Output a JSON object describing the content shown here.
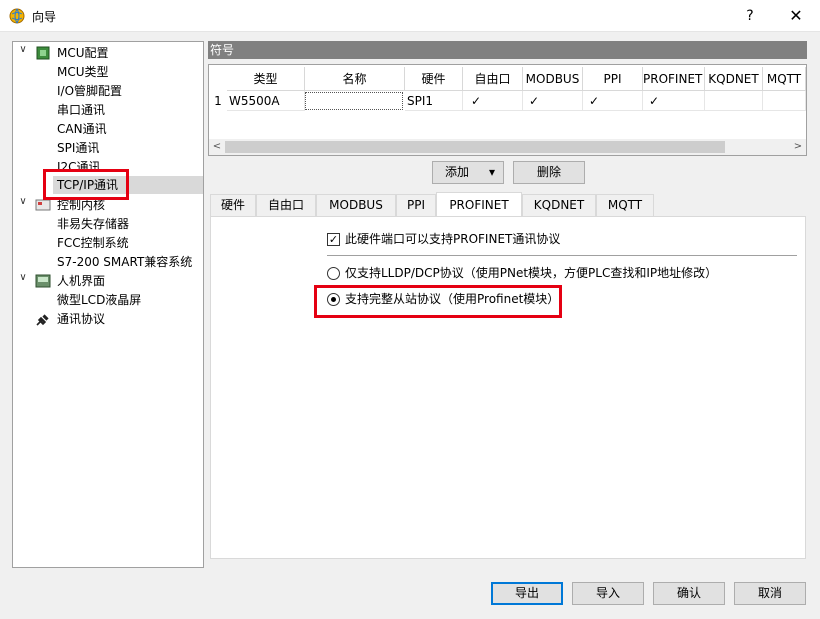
{
  "window": {
    "title": "向导",
    "help": "?",
    "close": "✕"
  },
  "tree": {
    "nodes": [
      {
        "label": "MCU配置",
        "toggle": "∨",
        "icon": "chip-icon"
      },
      {
        "label": "MCU类型"
      },
      {
        "label": "I/O管脚配置"
      },
      {
        "label": "串口通讯"
      },
      {
        "label": "CAN通讯"
      },
      {
        "label": "SPI通讯"
      },
      {
        "label": "I2C通讯"
      },
      {
        "label": "TCP/IP通讯"
      },
      {
        "label": "控制内核",
        "toggle": "∨",
        "icon": "core-icon"
      },
      {
        "label": "非易失存储器"
      },
      {
        "label": "FCC控制系统"
      },
      {
        "label": "S7-200 SMART兼容系统"
      },
      {
        "label": "人机界面",
        "toggle": "∨",
        "icon": "hmi-icon"
      },
      {
        "label": "微型LCD液晶屏"
      },
      {
        "label": "通讯协议",
        "icon": "plug-icon"
      }
    ]
  },
  "grid": {
    "header": "符号",
    "columns": [
      "类型",
      "名称",
      "硬件",
      "自由口",
      "MODBUS",
      "PPI",
      "PROFINET",
      "KQDNET",
      "MQTT"
    ],
    "row": {
      "num": "1",
      "type": "W5500A",
      "name": "",
      "hardware": "SPI1",
      "checks": [
        "✓",
        "✓",
        "✓",
        "✓"
      ]
    },
    "scroll_left": "<",
    "scroll_right": ">"
  },
  "buttons": {
    "add": "添加",
    "add_arrow": "▾",
    "delete": "删除",
    "export": "导出",
    "import": "导入",
    "ok": "确认",
    "cancel": "取消"
  },
  "tabs": [
    "硬件",
    "自由口",
    "MODBUS",
    "PPI",
    "PROFINET",
    "KQDNET",
    "MQTT"
  ],
  "profinet": {
    "checkbox_label": "此硬件端口可以支持PROFINET通讯协议",
    "checkbox_mark": "✓",
    "radio1_label": "仅支持LLDP/DCP协议（使用PNet模块，方便PLC查找和IP地址修改）",
    "radio2_label": "支持完整从站协议（使用Profinet模块）"
  },
  "colors": {
    "highlight": "#e50012",
    "header_bg": "#808080"
  }
}
